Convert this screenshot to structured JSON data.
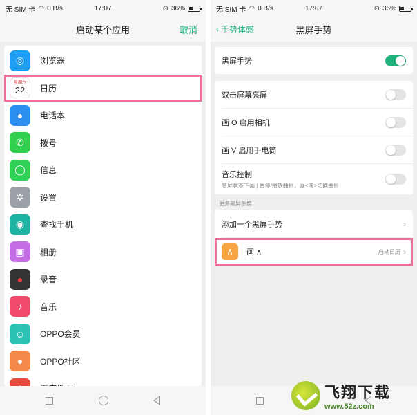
{
  "status_bar": {
    "carrier": "无 SIM 卡",
    "speed": "0 B/s",
    "time": "17:07",
    "battery": "36%",
    "battery_level": 0.36
  },
  "left_screen": {
    "title": "启动某个应用",
    "cancel_label": "取消",
    "apps": [
      {
        "label": "浏览器",
        "icon": "browser-icon",
        "color": "#1e9ff2"
      },
      {
        "label": "日历",
        "icon": "calendar-icon",
        "color": "#ffffff",
        "calendar_weekday": "星期六",
        "calendar_day": "22"
      },
      {
        "label": "电话本",
        "icon": "contacts-icon",
        "color": "#2a8ff0"
      },
      {
        "label": "拨号",
        "icon": "phone-icon",
        "color": "#30cf4e"
      },
      {
        "label": "信息",
        "icon": "messages-icon",
        "color": "#31d057"
      },
      {
        "label": "设置",
        "icon": "settings-icon",
        "color": "#9aa0a6"
      },
      {
        "label": "查找手机",
        "icon": "find-phone-icon",
        "color": "#1fb3a3"
      },
      {
        "label": "相册",
        "icon": "gallery-icon",
        "color": "#c46fe6"
      },
      {
        "label": "录音",
        "icon": "recorder-icon",
        "color": "#333333"
      },
      {
        "label": "音乐",
        "icon": "music-icon",
        "color": "#f04a6a"
      },
      {
        "label": "OPPO会员",
        "icon": "oppo-member-icon",
        "color": "#2cc2b5"
      },
      {
        "label": "OPPO社区",
        "icon": "oppo-community-icon",
        "color": "#f2894a"
      },
      {
        "label": "百度地图",
        "icon": "baidu-map-icon",
        "color": "#e84b3c"
      }
    ]
  },
  "right_screen": {
    "back_label": "手势体感",
    "title": "黑屏手势",
    "master_toggle": {
      "label": "黑屏手势",
      "on": true
    },
    "options": [
      {
        "label": "双击屏幕亮屏",
        "on": false,
        "subtext": ""
      },
      {
        "label": "画 O 启用相机",
        "on": false,
        "subtext": ""
      },
      {
        "label": "画 V 启用手电筒",
        "on": false,
        "subtext": ""
      },
      {
        "label": "音乐控制",
        "on": false,
        "subtext": "息屏状态下画 | 暂停/播放曲目，画<或>切换曲目"
      }
    ],
    "section_label": "更多黑屏手势",
    "add_gesture_label": "添加一个黑屏手势",
    "custom_gesture": {
      "symbol": "∧",
      "label": "画 ∧",
      "action": "启动日历"
    }
  },
  "watermark": {
    "title": "飞翔下载",
    "url": "www.52z.com"
  },
  "colors": {
    "accent": "#1fb47e",
    "highlight": "#ee6f9b"
  }
}
